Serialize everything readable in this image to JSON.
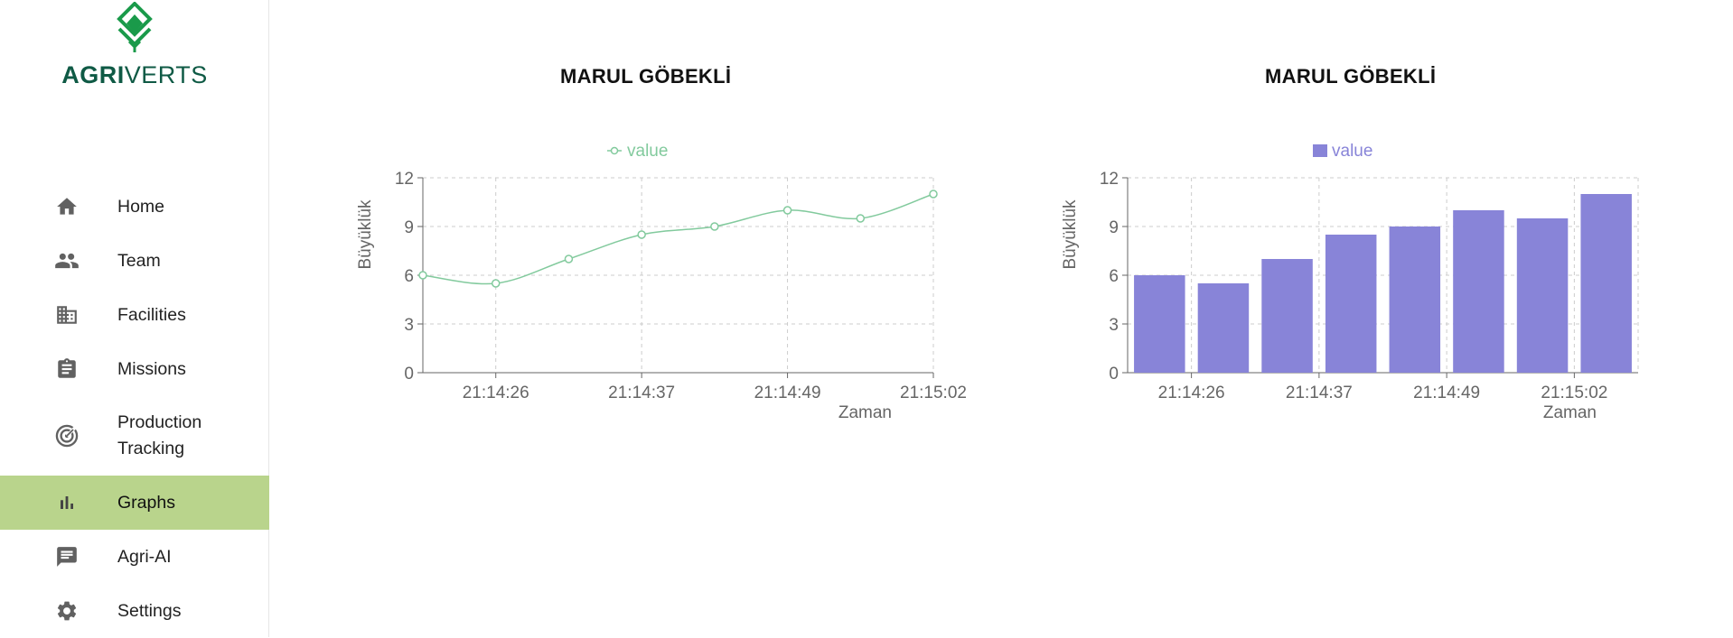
{
  "brand": {
    "name_part1": "AGRI",
    "name_part2": "VERTS",
    "color": "#0f5a45",
    "accent": "#1a9a4a"
  },
  "sidebar": {
    "active_color": "#b9d48c",
    "items": [
      {
        "label": "Home",
        "icon": "home-icon"
      },
      {
        "label": "Team",
        "icon": "people-icon"
      },
      {
        "label": "Facilities",
        "icon": "building-icon"
      },
      {
        "label": "Missions",
        "icon": "clipboard-icon"
      },
      {
        "label_line1": "Production",
        "label_line2": "Tracking",
        "icon": "radar-icon"
      },
      {
        "label": "Graphs",
        "icon": "bar-chart-icon",
        "active": true
      },
      {
        "label": "Agri-AI",
        "icon": "chat-icon"
      },
      {
        "label": "Settings",
        "icon": "gear-icon"
      }
    ]
  },
  "charts": [
    {
      "title": "MARUL GÖBEKLİ"
    },
    {
      "title": "MARUL GÖBEKLİ"
    }
  ],
  "chart_data": [
    {
      "type": "line",
      "title": "MARUL GÖBEKLİ",
      "legend": "value",
      "legend_position": "top-center",
      "color": "#82ca9d",
      "xlabel": "Zaman",
      "ylabel": "Büyüklük",
      "x_ticks": [
        "21:14:26",
        "21:14:37",
        "21:14:49",
        "21:15:02"
      ],
      "values": [
        6,
        5.5,
        7,
        8.5,
        9,
        10,
        9.5,
        11
      ],
      "ylim": [
        0,
        12
      ],
      "y_ticks": [
        0,
        3,
        6,
        9,
        12
      ],
      "grid": true
    },
    {
      "type": "bar",
      "title": "MARUL GÖBEKLİ",
      "legend": "value",
      "legend_position": "top-center",
      "color": "#8884d8",
      "xlabel": "Zaman",
      "ylabel": "Büyüklük",
      "x_ticks": [
        "21:14:26",
        "21:14:37",
        "21:14:49",
        "21:15:02"
      ],
      "values": [
        6,
        5.5,
        7,
        8.5,
        9,
        10,
        9.5,
        11
      ],
      "ylim": [
        0,
        12
      ],
      "y_ticks": [
        0,
        3,
        6,
        9,
        12
      ],
      "grid": true
    }
  ]
}
